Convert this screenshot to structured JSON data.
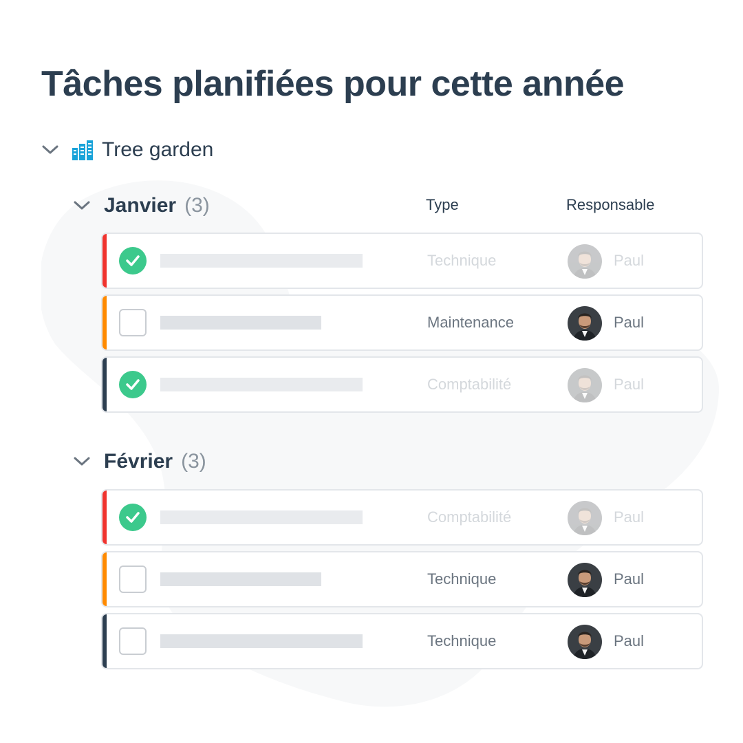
{
  "page": {
    "title": "Tâches planifiées pour cette année"
  },
  "project": {
    "name": "Tree garden",
    "icon": "building-icon",
    "icon_color": "#1aa3d9"
  },
  "columns": {
    "type": "Type",
    "owner": "Responsable"
  },
  "colors": {
    "red": "#f0332e",
    "orange": "#ff8a00",
    "navy": "#2c3e50",
    "done_green": "#3cc98c"
  },
  "groups": [
    {
      "title": "Janvier",
      "count": "(3)",
      "tasks": [
        {
          "done": true,
          "accent": "red",
          "type": "Technique",
          "owner": "Paul"
        },
        {
          "done": false,
          "accent": "orange",
          "type": "Maintenance",
          "owner": "Paul"
        },
        {
          "done": true,
          "accent": "navy",
          "type": "Comptabilité",
          "owner": "Paul"
        }
      ]
    },
    {
      "title": "Février",
      "count": "(3)",
      "tasks": [
        {
          "done": true,
          "accent": "red",
          "type": "Comptabilité",
          "owner": "Paul"
        },
        {
          "done": false,
          "accent": "orange",
          "type": "Technique",
          "owner": "Paul"
        },
        {
          "done": false,
          "accent": "navy",
          "type": "Technique",
          "owner": "Paul"
        }
      ]
    }
  ]
}
